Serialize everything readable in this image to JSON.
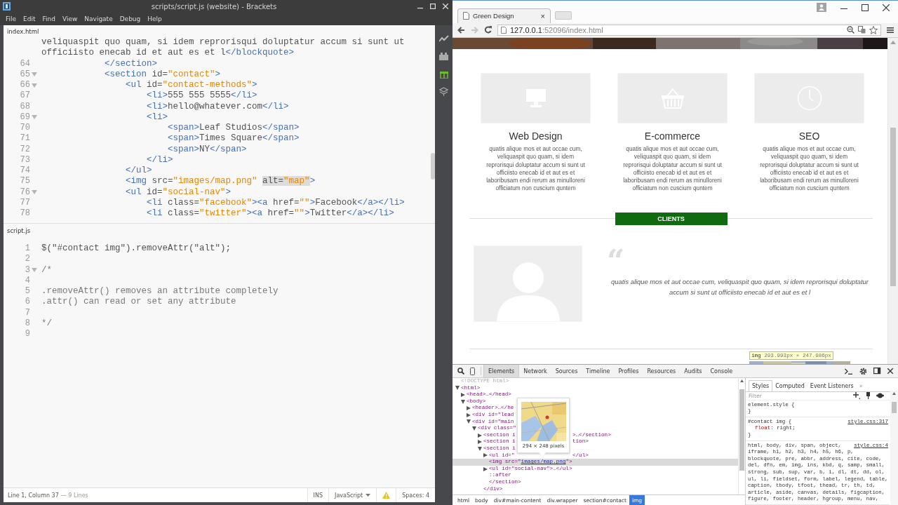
{
  "editor": {
    "title": "scripts/script.js (website) - Brackets",
    "menu": [
      "File",
      "Edit",
      "Find",
      "View",
      "Navigate",
      "Debug",
      "Help"
    ],
    "panes": [
      {
        "file": "index.html",
        "lines": [
          {
            "fold": false,
            "tokens": [
              {
                "kind": "text",
                "text": "veliquaspit quo quam, si idem reprorisqui doluptatur accum si sunt ut"
              }
            ]
          },
          {
            "fold": false,
            "tokens": [
              {
                "kind": "text",
                "text": "officiisto enecab id et aut es et l"
              },
              {
                "kind": "tag",
                "text": "</blockquote>"
              }
            ]
          },
          {
            "num": "64",
            "fold": false,
            "tokens": [
              {
                "kind": "tag",
                "text": "            </section>"
              }
            ]
          },
          {
            "num": "65",
            "fold": true,
            "tokens": [
              {
                "kind": "tag",
                "text": "            <section"
              },
              {
                "kind": "attr",
                "text": " id="
              },
              {
                "kind": "string",
                "text": "\"contact\""
              },
              {
                "kind": "tag",
                "text": ">"
              }
            ]
          },
          {
            "num": "66",
            "fold": true,
            "tokens": [
              {
                "kind": "tag",
                "text": "                <ul"
              },
              {
                "kind": "attr",
                "text": " id="
              },
              {
                "kind": "string",
                "text": "\"contact-methods\""
              },
              {
                "kind": "tag",
                "text": ">"
              }
            ]
          },
          {
            "num": "67",
            "fold": false,
            "tokens": [
              {
                "kind": "tag",
                "text": "                    <li>"
              },
              {
                "kind": "text",
                "text": "555 555 5555"
              },
              {
                "kind": "tag",
                "text": "</li>"
              }
            ]
          },
          {
            "num": "68",
            "fold": false,
            "tokens": [
              {
                "kind": "tag",
                "text": "                    <li>"
              },
              {
                "kind": "text",
                "text": "hello@whatever.com"
              },
              {
                "kind": "tag",
                "text": "</li>"
              }
            ]
          },
          {
            "num": "69",
            "fold": true,
            "tokens": [
              {
                "kind": "tag",
                "text": "                    <li>"
              }
            ]
          },
          {
            "num": "70",
            "fold": false,
            "tokens": [
              {
                "kind": "tag",
                "text": "                        <span>"
              },
              {
                "kind": "text",
                "text": "Leaf Studios"
              },
              {
                "kind": "tag",
                "text": "</span>"
              }
            ]
          },
          {
            "num": "71",
            "fold": false,
            "tokens": [
              {
                "kind": "tag",
                "text": "                        <span>"
              },
              {
                "kind": "text",
                "text": "Times Square"
              },
              {
                "kind": "tag",
                "text": "</span>"
              }
            ]
          },
          {
            "num": "72",
            "fold": false,
            "tokens": [
              {
                "kind": "tag",
                "text": "                        <span>"
              },
              {
                "kind": "text",
                "text": "NY"
              },
              {
                "kind": "tag",
                "text": "</span>"
              }
            ]
          },
          {
            "num": "73",
            "fold": false,
            "tokens": [
              {
                "kind": "tag",
                "text": "                    </li>"
              }
            ]
          },
          {
            "num": "74",
            "fold": false,
            "tokens": [
              {
                "kind": "tag",
                "text": "                </ul>"
              }
            ]
          },
          {
            "num": "75",
            "fold": false,
            "tokens": [
              {
                "kind": "tag",
                "text": "                <img"
              },
              {
                "kind": "attr",
                "text": " src="
              },
              {
                "kind": "string",
                "text": "\"images/map.png\" "
              },
              {
                "kind": "attr-match",
                "text": "alt="
              },
              {
                "kind": "string-match",
                "text": "\"map\""
              },
              {
                "kind": "tag",
                "text": ">"
              }
            ]
          },
          {
            "num": "76",
            "fold": true,
            "tokens": [
              {
                "kind": "tag",
                "text": "                <ul"
              },
              {
                "kind": "attr",
                "text": " id="
              },
              {
                "kind": "string",
                "text": "\"social-nav\""
              },
              {
                "kind": "tag",
                "text": ">"
              }
            ]
          },
          {
            "num": "77",
            "fold": false,
            "tokens": [
              {
                "kind": "tag",
                "text": "                    <li"
              },
              {
                "kind": "attr",
                "text": " class="
              },
              {
                "kind": "string",
                "text": "\"facebook\""
              },
              {
                "kind": "tag",
                "text": "><a"
              },
              {
                "kind": "attr",
                "text": " href="
              },
              {
                "kind": "string",
                "text": "\"\""
              },
              {
                "kind": "tag",
                "text": ">"
              },
              {
                "kind": "text",
                "text": "Facebook"
              },
              {
                "kind": "tag",
                "text": "</a></li>"
              }
            ]
          },
          {
            "num": "78",
            "fold": false,
            "tokens": [
              {
                "kind": "tag",
                "text": "                    <li"
              },
              {
                "kind": "attr",
                "text": " class="
              },
              {
                "kind": "string",
                "text": "\"twitter\""
              },
              {
                "kind": "tag",
                "text": "><a"
              },
              {
                "kind": "attr",
                "text": " href="
              },
              {
                "kind": "string",
                "text": "\"\""
              },
              {
                "kind": "tag",
                "text": ">"
              },
              {
                "kind": "text",
                "text": "Twitter"
              },
              {
                "kind": "tag",
                "text": "</a></li>"
              }
            ]
          }
        ]
      },
      {
        "file": "script.js",
        "lines": [
          {
            "num": "1",
            "fold": false,
            "tokens": [
              {
                "kind": "text",
                "text": "$(\"#contact img\").removeAttr(\"alt\");"
              }
            ]
          },
          {
            "num": "2",
            "fold": false
          },
          {
            "num": "3",
            "fold": true,
            "tokens": [
              {
                "kind": "comment",
                "text": "/*"
              }
            ]
          },
          {
            "num": "4",
            "fold": false
          },
          {
            "num": "5",
            "fold": false,
            "tokens": [
              {
                "kind": "comment",
                "text": ".removeAttr() removes an attribute completely"
              }
            ]
          },
          {
            "num": "6",
            "fold": false,
            "tokens": [
              {
                "kind": "comment",
                "text": ".attr() can read or set any attribute"
              }
            ]
          },
          {
            "num": "7",
            "fold": false
          },
          {
            "num": "8",
            "fold": false,
            "tokens": [
              {
                "kind": "comment",
                "text": "*/"
              }
            ]
          },
          {
            "num": "9",
            "fold": false
          }
        ]
      }
    ],
    "status": {
      "cursor": "Line 1, Column 37",
      "line_count": "— 9 Lines",
      "mode": "INS",
      "language": "JavaScript",
      "spaces": "Spaces: 4"
    }
  },
  "browser": {
    "tab": {
      "title": "Green Design",
      "close": "×"
    },
    "forward_enabled": false,
    "address": {
      "host": "127.0.0.1",
      "path": ":52096/index.html"
    },
    "page": {
      "services": [
        {
          "title": "Web Design",
          "text": "quatis alique mos et aut occae cum, veliquaspit quo quam, si idem reprorisqui doluptatur accum si sunt ut officiisto enecab id et aut es et laboribusam endi rerum as minulloreni officiatum non cuscium quntem"
        },
        {
          "title": "E-commerce",
          "text": "quatis alique mos et aut occae cum, veliquaspit quo quam, si idem reprorisqui doluptatur accum si sunt ut officiisto enecab id et aut es et laboribusam endi rerum as minulloreni officiatum non cuscium quntem"
        },
        {
          "title": "SEO",
          "text": "quatis alique mos et aut occae cum, veliquaspit quo quam, si idem reprorisqui doluptatur accum si sunt ut officiisto enecab id et aut es et laboribusam endi rerum as minulloreni officiatum non cuscium quntem"
        }
      ],
      "clients_button": "CLIENTS",
      "quote_mark": "“",
      "quote": "quatis alique mos et aut occae cum, veliquaspit quo quam, si idem reprorisqui doluptatur accum si sunt ut officiisto enecab id et aut es et l",
      "inspect_tooltip": {
        "tag": "img",
        "size": "293.993px × 247.986px"
      }
    },
    "devtools": {
      "tabs": [
        {
          "label": "Elements",
          "selected": true
        },
        {
          "label": "Network",
          "selected": false
        },
        {
          "label": "Sources",
          "selected": false
        },
        {
          "label": "Timeline",
          "selected": false
        },
        {
          "label": "Profiles",
          "selected": false
        },
        {
          "label": "Resources",
          "selected": false
        },
        {
          "label": "Audits",
          "selected": false
        },
        {
          "label": "Console",
          "selected": false
        }
      ],
      "dom": [
        {
          "text": "<!DOCTYPE html>",
          "kind": "doctype",
          "selected": false
        },
        {
          "text": "<html>",
          "kind": "element",
          "expanded": true,
          "selected": false,
          "children": [
            {
              "text": "<head>…</head>",
              "kind": "element",
              "expanded": false,
              "selected": false
            },
            {
              "text": "<body>",
              "kind": "element",
              "expanded": true,
              "selected": false,
              "children": [
                {
                  "text": "<header>…</he",
                  "kind": "element",
                  "expanded": false,
                  "selected": false
                },
                {
                  "text": "<div id=\"lead",
                  "kind": "element",
                  "expanded": false,
                  "selected": false
                },
                {
                  "text": "<div id=\"main",
                  "kind": "element",
                  "expanded": true,
                  "selected": false,
                  "children": [
                    {
                      "text": "<div class=\"",
                      "kind": "element",
                      "expanded": true,
                      "selected": false,
                      "children": [
                        {
                          "text": "<section i",
                          "tail": ">…</section>",
                          "kind": "element",
                          "expanded": false,
                          "selected": false
                        },
                        {
                          "text": "<section i",
                          "tail": "tion>",
                          "kind": "element",
                          "expanded": false,
                          "selected": false
                        },
                        {
                          "text": "<section i",
                          "kind": "element",
                          "expanded": true,
                          "selected": false,
                          "children": [
                            {
                              "text": "<ul id=\"",
                              "tail": "</ul>",
                              "kind": "element",
                              "expanded": false,
                              "selected": false
                            },
                            {
                              "text": "<img src=\"",
                              "link": "images/map.png",
                              "after": "\">",
                              "kind": "leaf",
                              "selected": true
                            },
                            {
                              "text": "<ul id=\"social-nav\">…</ul>",
                              "kind": "element",
                              "expanded": false,
                              "selected": false
                            },
                            {
                              "text": "::after",
                              "kind": "leaf",
                              "selected": false
                            },
                            {
                              "text": "</section>",
                              "kind": "leaf",
                              "selected": false
                            }
                          ]
                        },
                        {
                          "text": "</div>",
                          "kind": "leaf",
                          "selected": false
                        }
                      ]
                    }
                  ]
                }
              ]
            }
          ]
        }
      ],
      "image_preview": "294 × 248 pixels",
      "breadcrumbs": [
        {
          "label": "html",
          "selected": false
        },
        {
          "label": "body",
          "selected": false
        },
        {
          "label": "div#main-content",
          "selected": false
        },
        {
          "label": "div.wrapper",
          "selected": false
        },
        {
          "label": "section#contact",
          "selected": false
        },
        {
          "label": "img",
          "selected": true
        }
      ],
      "styles": {
        "tabs": [
          {
            "label": "Styles",
            "selected": true
          },
          {
            "label": "Computed",
            "selected": false
          },
          {
            "label": "Event Listeners",
            "selected": false
          }
        ],
        "more": "»",
        "filter_placeholder": "Filter",
        "rules": [
          {
            "selector": [
              "element.style {"
            ],
            "closing": "}"
          },
          {
            "selector": [
              "#contact img {"
            ],
            "source": "style.css:317",
            "declarations": [
              {
                "property": "float",
                "value": ": right;"
              }
            ],
            "closing": "}"
          },
          {
            "selector": [
              "html, body, div, span, object,",
              "iframe, h1, h2, h3, h4, h5, h6, p,",
              "blockquote, pre, abbr, address, cite, code,",
              "del, dfn, em, img, ins, kbd, q, samp, small,",
              "strong, sub, sup, var, b, i, dl, dt, dd, ol,",
              "ul, li, fieldset, form, label, legend, table,",
              "caption, tbody, tfoot, thead, tr, th, td,",
              "article, aside, canvas, details, figcaption,",
              "figure, footer, header, hgroup, menu, nav,"
            ],
            "source": "style.css:4"
          }
        ]
      }
    }
  }
}
